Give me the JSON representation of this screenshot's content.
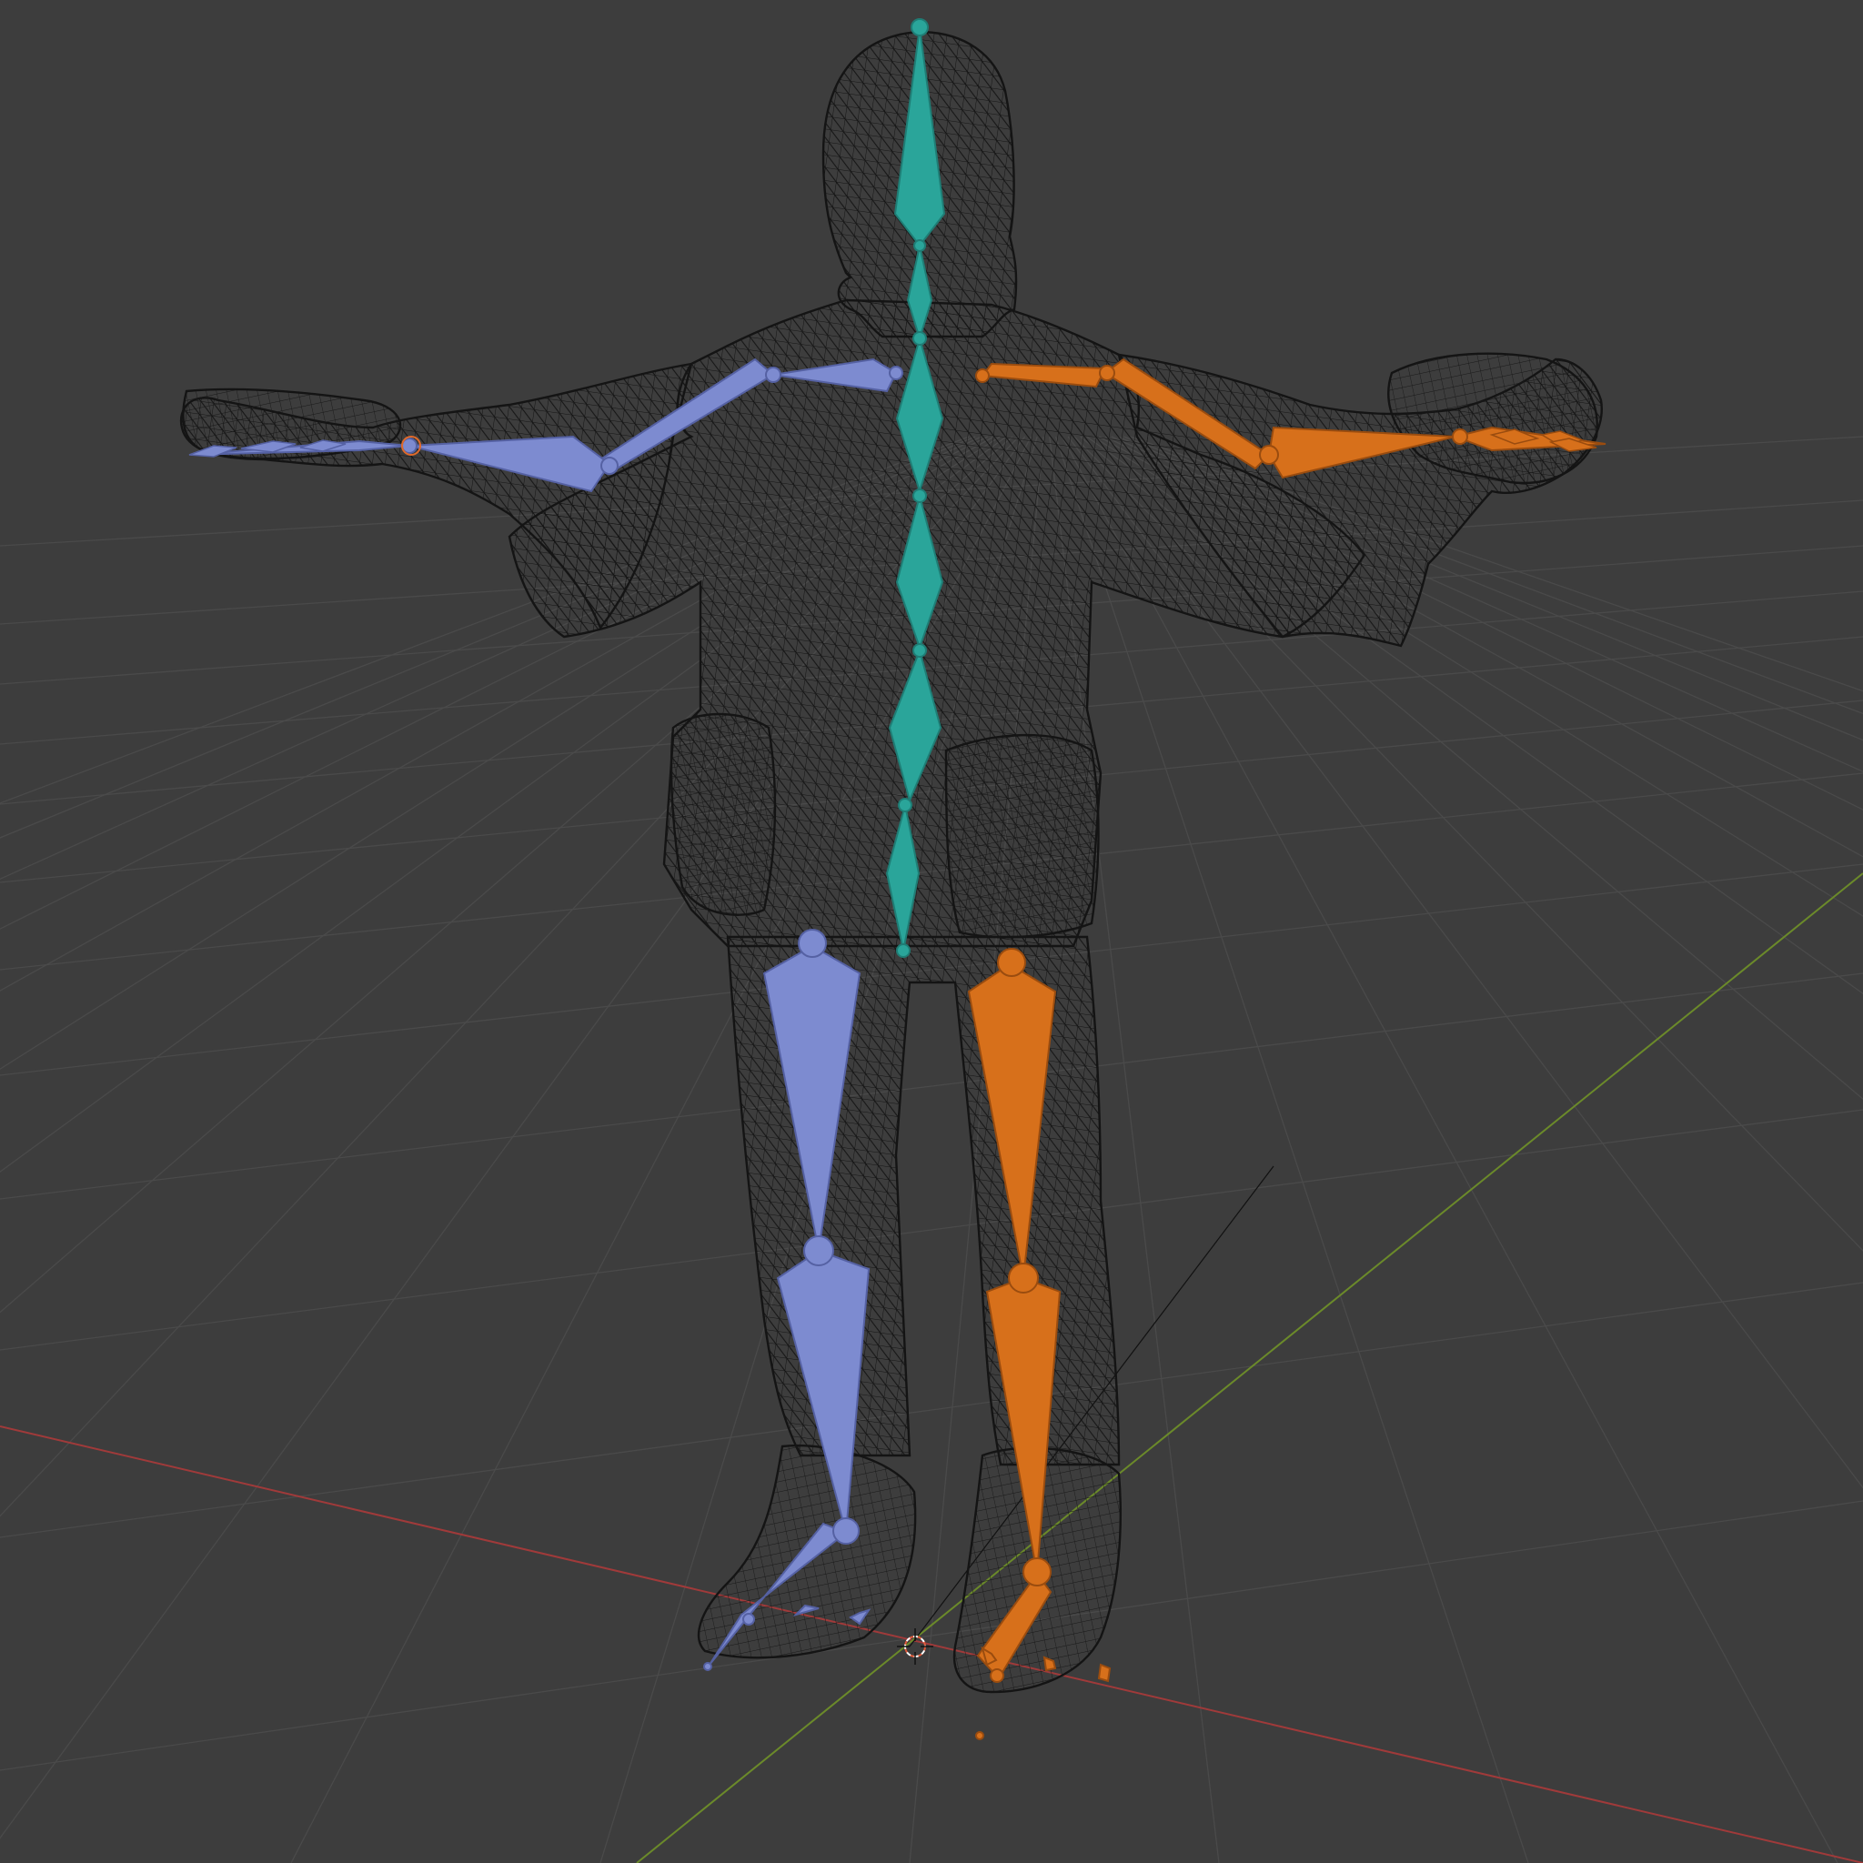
{
  "viewport": {
    "kind": "3D viewport — wireframe character with armature, T-pose",
    "background_color": "#3d3d3d",
    "grid_color": "#4a4a4a",
    "x_axis_color": "#a03a3a",
    "y_axis_color": "#6b8a2a",
    "mesh_wire_color": "#141414",
    "bone_colors": {
      "center": "#2aa59a",
      "left_side": "#7d8bd0",
      "right_side": "#d7701b"
    },
    "icons": [
      "3d-cursor-icon"
    ]
  }
}
